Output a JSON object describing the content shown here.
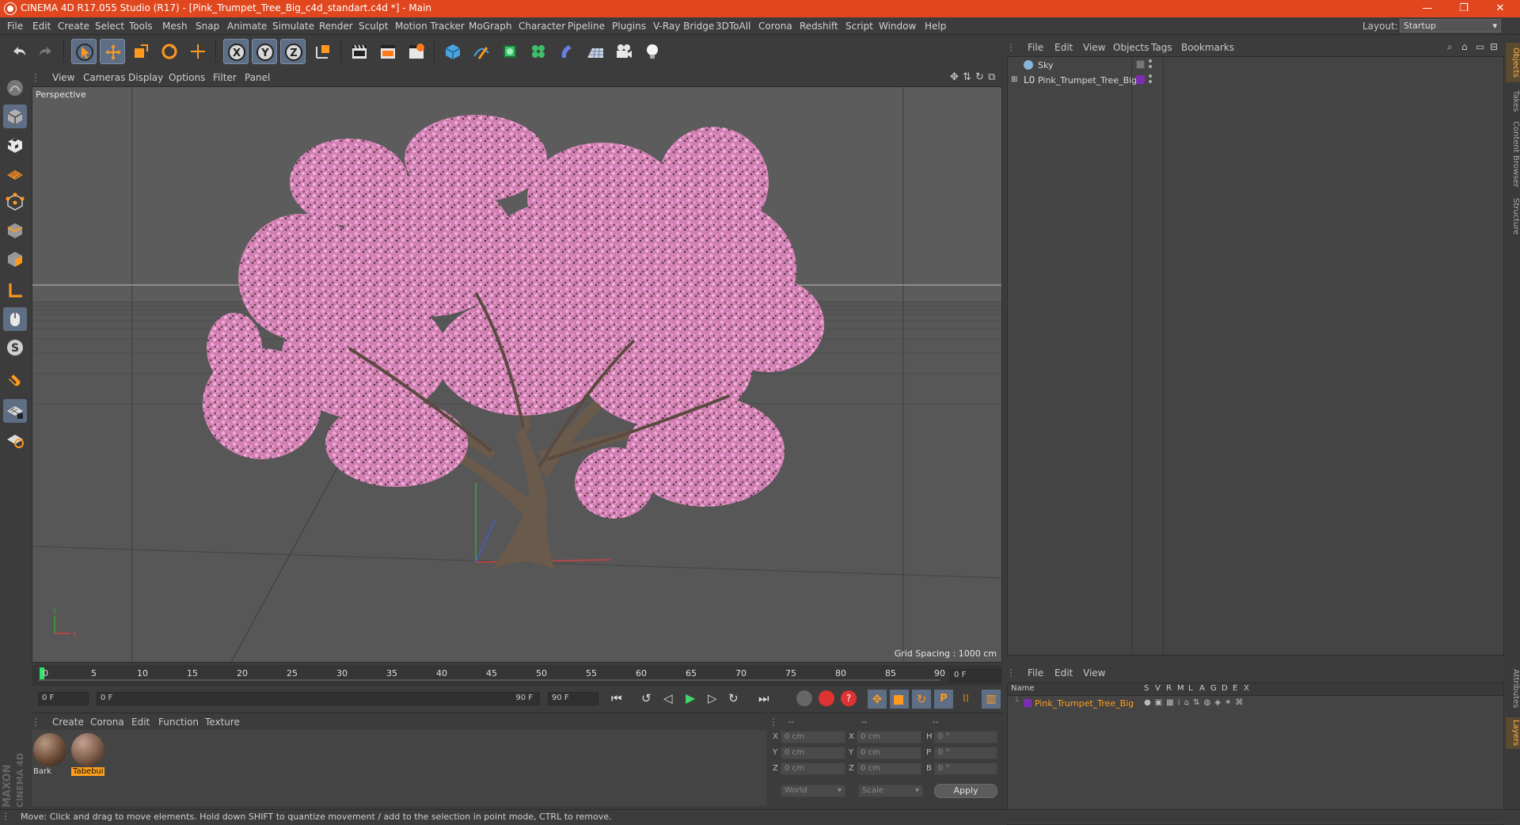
{
  "window": {
    "title": "CINEMA 4D R17.055 Studio (R17) - [Pink_Trumpet_Tree_Big_c4d_standart.c4d *] - Main",
    "controls": [
      "—",
      "❐",
      "✕"
    ]
  },
  "menu": [
    "File",
    "Edit",
    "Create",
    "Select",
    "Tools",
    "Mesh",
    "Snap",
    "Animate",
    "Simulate",
    "Render",
    "Sculpt",
    "Motion Tracker",
    "MoGraph",
    "Character",
    "Pipeline",
    "Plugins",
    "V-Ray Bridge",
    "3DToAll",
    "Corona",
    "Redshift",
    "Script",
    "Window",
    "Help"
  ],
  "layout": {
    "label": "Layout:",
    "value": "Startup"
  },
  "viewport": {
    "menu": [
      "View",
      "Cameras",
      "Display",
      "Options",
      "Filter",
      "Panel"
    ],
    "label": "Perspective",
    "grid_spacing": "Grid Spacing : 1000 cm"
  },
  "timeline": {
    "ticks": [
      "0",
      "5",
      "10",
      "15",
      "20",
      "25",
      "30",
      "35",
      "40",
      "45",
      "50",
      "55",
      "60",
      "65",
      "70",
      "75",
      "80",
      "85",
      "90"
    ],
    "current_frame": "0 F",
    "start": "0 F",
    "range_start": "0 F",
    "range_end": "90 F",
    "end": "90 F"
  },
  "materials": {
    "menu": [
      "Create",
      "Corona",
      "Edit",
      "Function",
      "Texture"
    ],
    "items": [
      {
        "name": "Bark",
        "color": "#6b4a36"
      },
      {
        "name": "Tabebui",
        "color": "#7a5a48"
      }
    ]
  },
  "coordinates": {
    "headers": [
      "--",
      "--",
      "--"
    ],
    "rows": [
      {
        "a": "X",
        "av": "0 cm",
        "b": "X",
        "bv": "0 cm",
        "c": "H",
        "cv": "0 °"
      },
      {
        "a": "Y",
        "av": "0 cm",
        "b": "Y",
        "bv": "0 cm",
        "c": "P",
        "cv": "0 °"
      },
      {
        "a": "Z",
        "av": "0 cm",
        "b": "Z",
        "bv": "0 cm",
        "c": "B",
        "cv": "0 °"
      }
    ],
    "space": "World",
    "mode": "Scale",
    "apply": "Apply"
  },
  "object_manager": {
    "menu": [
      "File",
      "Edit",
      "View",
      "Objects",
      "Tags",
      "Bookmarks"
    ],
    "objects": [
      {
        "name": "Sky"
      },
      {
        "name": "Pink_Trumpet_Tree_Big"
      }
    ]
  },
  "layers": {
    "menu": [
      "File",
      "Edit",
      "View"
    ],
    "columns": [
      "Name",
      "S",
      "V",
      "R",
      "M",
      "L",
      "A",
      "G",
      "D",
      "E",
      "X"
    ],
    "rows": [
      {
        "name": "Pink_Trumpet_Tree_Big",
        "color": "#7a2fb0"
      }
    ]
  },
  "right_tabs": [
    "Objects",
    "Takes",
    "Content Browser",
    "Structure",
    "Attributes",
    "Layers"
  ],
  "status": "Move: Click and drag to move elements. Hold down SHIFT to quantize movement / add to the selection in point mode, CTRL to remove.",
  "branding": {
    "maxon": "MAXON",
    "product": "CINEMA 4D"
  },
  "colors": {
    "accent": "#e0471e",
    "selected_tool": "#5e6e85",
    "blossom": "#e58fc4",
    "layer_name": "#ff9f1a"
  }
}
